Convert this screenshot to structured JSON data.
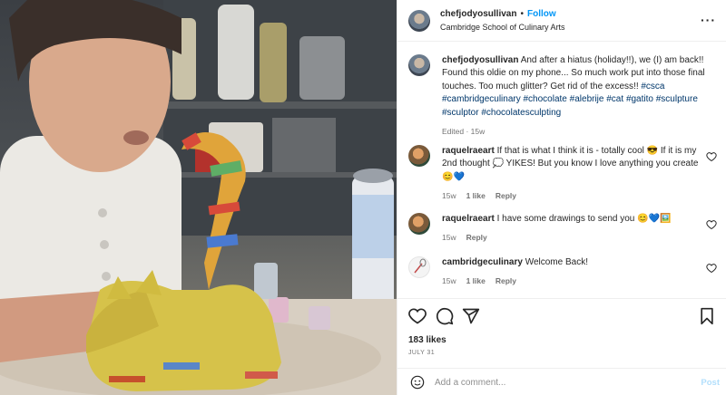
{
  "post": {
    "username": "chefjodyosullivan",
    "separator": "•",
    "follow_label": "Follow",
    "location": "Cambridge School of Culinary Arts",
    "more_icon": "more-horizontal-icon"
  },
  "caption": {
    "username": "chefjodyosullivan",
    "text": "And after a hiatus (holiday!!), we (I) am back!! Found this oldie on my phone... So much work put into those final touches. Too much glitter? Get rid of the excess!!",
    "hashtags": [
      "#csca",
      "#cambridgeculinary",
      "#chocolate",
      "#alebrije",
      "#cat",
      "#gatito",
      "#sculpture",
      "#sculptor",
      "#chocolatesculpting"
    ],
    "meta": "Edited · 15w"
  },
  "comments": [
    {
      "username": "raquelraeart",
      "text": "If that is what I think it is - totally cool 😎 If it is my 2nd thought 💭 YIKES! But you know I love anything you create 😊💙",
      "age": "15w",
      "likes": "1 like",
      "reply": "Reply"
    },
    {
      "username": "raquelraeart",
      "text": "I have some drawings to send you 😊💙🖼️",
      "age": "15w",
      "likes": "",
      "reply": "Reply"
    },
    {
      "username": "cambridgeculinary",
      "text": "Welcome Back!",
      "age": "15w",
      "likes": "1 like",
      "reply": "Reply"
    }
  ],
  "stats": {
    "likes": "183 likes",
    "date": "JULY 31"
  },
  "add_comment": {
    "placeholder": "Add a comment...",
    "post_label": "Post"
  },
  "colors": {
    "link": "#0095f6",
    "hashtag": "#00376b",
    "muted": "#737373",
    "post_disabled": "#b2dffc"
  }
}
